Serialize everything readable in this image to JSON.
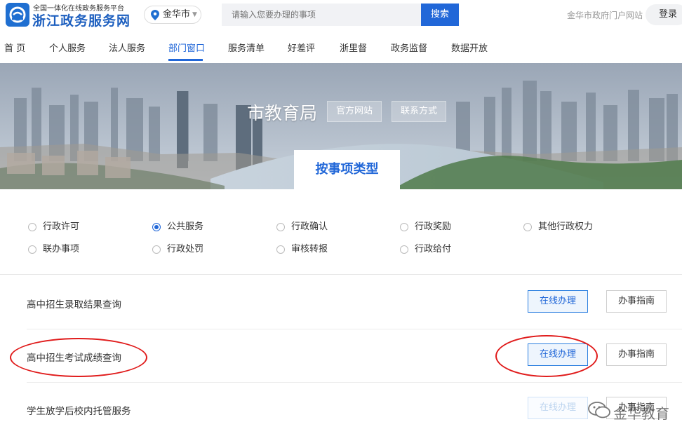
{
  "header": {
    "subtitle": "全国一体化在线政务服务平台",
    "title": "浙江政务服务网",
    "city": "金华市",
    "search_placeholder": "请输入您要办理的事项",
    "search_button": "搜索",
    "portal_link": "金华市政府门户网站",
    "login": "登录"
  },
  "nav": {
    "items": [
      "首 页",
      "个人服务",
      "法人服务",
      "部门窗口",
      "服务清单",
      "好差评",
      "浙里督",
      "政务监督",
      "数据开放"
    ],
    "active": "部门窗口"
  },
  "banner": {
    "department": "市教育局",
    "official_site": "官方网站",
    "contact": "联系方式",
    "tab": "按事项类型"
  },
  "filters": {
    "items": [
      "行政许可",
      "公共服务",
      "行政确认",
      "行政奖励",
      "其他行政权力",
      "联办事项",
      "行政处罚",
      "审核转报",
      "行政给付"
    ],
    "selected": "公共服务"
  },
  "services": [
    {
      "title": "高中招生录取结果查询",
      "online": "在线办理",
      "guide": "办事指南"
    },
    {
      "title": "高中招生考试成绩查询",
      "online": "在线办理",
      "guide": "办事指南"
    },
    {
      "title": "学生放学后校内托管服务",
      "online": "在线办理",
      "guide": "办事指南"
    }
  ],
  "watermark": "金华教育",
  "colors": {
    "accent": "#2167d8",
    "annotation": "#e01b1b"
  },
  "icons": {
    "logo": "zhejiang-gov-logo",
    "city": "location-pin-icon",
    "dropdown": "chevron-down-icon",
    "watermark": "wechat-icon"
  }
}
